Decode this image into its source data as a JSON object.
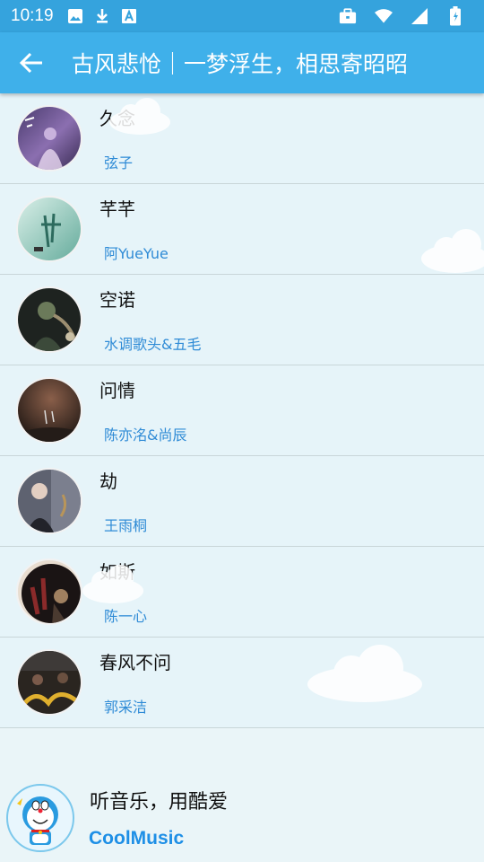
{
  "status_bar": {
    "time": "10:19",
    "left_icons": [
      "image-icon",
      "download-icon",
      "text-app-icon"
    ],
    "right_icons": [
      "briefcase-icon",
      "wifi-icon",
      "signal-icon",
      "battery-icon"
    ]
  },
  "toolbar": {
    "title": "古风悲怆｜一梦浮生，相思寄昭昭",
    "back_icon": "arrow-left-icon"
  },
  "songs": [
    {
      "title": "久念",
      "artist": "弦子"
    },
    {
      "title": "芊芊",
      "artist": "阿YueYue"
    },
    {
      "title": "空诺",
      "artist": "水调歌头&五毛"
    },
    {
      "title": "问情",
      "artist": "陈亦洺&尚辰"
    },
    {
      "title": "劫",
      "artist": "王雨桐"
    },
    {
      "title": "如斯",
      "artist": "陈一心"
    },
    {
      "title": "春风不问",
      "artist": "郭采洁"
    }
  ],
  "footer": {
    "slogan": "听音乐，用酷爱",
    "brand": "CoolMusic"
  },
  "colors": {
    "status_bar": "#35a3dd",
    "toolbar": "#3fb0ea",
    "artist_text": "#2f8bd6",
    "brand_text": "#1e8fe6",
    "background": "#e6f4f8"
  }
}
